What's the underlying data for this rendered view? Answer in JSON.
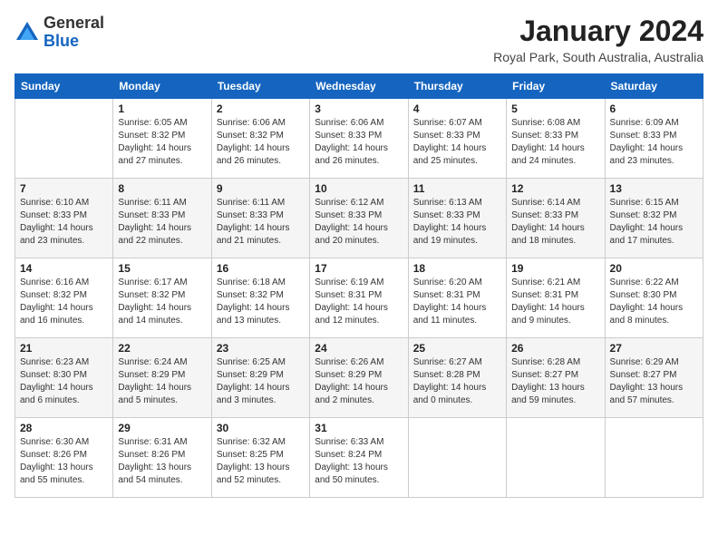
{
  "logo": {
    "general": "General",
    "blue": "Blue"
  },
  "title": "January 2024",
  "subtitle": "Royal Park, South Australia, Australia",
  "days_of_week": [
    "Sunday",
    "Monday",
    "Tuesday",
    "Wednesday",
    "Thursday",
    "Friday",
    "Saturday"
  ],
  "weeks": [
    [
      {
        "day": "",
        "sunrise": "",
        "sunset": "",
        "daylight": ""
      },
      {
        "day": "1",
        "sunrise": "Sunrise: 6:05 AM",
        "sunset": "Sunset: 8:32 PM",
        "daylight": "Daylight: 14 hours and 27 minutes."
      },
      {
        "day": "2",
        "sunrise": "Sunrise: 6:06 AM",
        "sunset": "Sunset: 8:32 PM",
        "daylight": "Daylight: 14 hours and 26 minutes."
      },
      {
        "day": "3",
        "sunrise": "Sunrise: 6:06 AM",
        "sunset": "Sunset: 8:33 PM",
        "daylight": "Daylight: 14 hours and 26 minutes."
      },
      {
        "day": "4",
        "sunrise": "Sunrise: 6:07 AM",
        "sunset": "Sunset: 8:33 PM",
        "daylight": "Daylight: 14 hours and 25 minutes."
      },
      {
        "day": "5",
        "sunrise": "Sunrise: 6:08 AM",
        "sunset": "Sunset: 8:33 PM",
        "daylight": "Daylight: 14 hours and 24 minutes."
      },
      {
        "day": "6",
        "sunrise": "Sunrise: 6:09 AM",
        "sunset": "Sunset: 8:33 PM",
        "daylight": "Daylight: 14 hours and 23 minutes."
      }
    ],
    [
      {
        "day": "7",
        "sunrise": "Sunrise: 6:10 AM",
        "sunset": "Sunset: 8:33 PM",
        "daylight": "Daylight: 14 hours and 23 minutes."
      },
      {
        "day": "8",
        "sunrise": "Sunrise: 6:11 AM",
        "sunset": "Sunset: 8:33 PM",
        "daylight": "Daylight: 14 hours and 22 minutes."
      },
      {
        "day": "9",
        "sunrise": "Sunrise: 6:11 AM",
        "sunset": "Sunset: 8:33 PM",
        "daylight": "Daylight: 14 hours and 21 minutes."
      },
      {
        "day": "10",
        "sunrise": "Sunrise: 6:12 AM",
        "sunset": "Sunset: 8:33 PM",
        "daylight": "Daylight: 14 hours and 20 minutes."
      },
      {
        "day": "11",
        "sunrise": "Sunrise: 6:13 AM",
        "sunset": "Sunset: 8:33 PM",
        "daylight": "Daylight: 14 hours and 19 minutes."
      },
      {
        "day": "12",
        "sunrise": "Sunrise: 6:14 AM",
        "sunset": "Sunset: 8:33 PM",
        "daylight": "Daylight: 14 hours and 18 minutes."
      },
      {
        "day": "13",
        "sunrise": "Sunrise: 6:15 AM",
        "sunset": "Sunset: 8:32 PM",
        "daylight": "Daylight: 14 hours and 17 minutes."
      }
    ],
    [
      {
        "day": "14",
        "sunrise": "Sunrise: 6:16 AM",
        "sunset": "Sunset: 8:32 PM",
        "daylight": "Daylight: 14 hours and 16 minutes."
      },
      {
        "day": "15",
        "sunrise": "Sunrise: 6:17 AM",
        "sunset": "Sunset: 8:32 PM",
        "daylight": "Daylight: 14 hours and 14 minutes."
      },
      {
        "day": "16",
        "sunrise": "Sunrise: 6:18 AM",
        "sunset": "Sunset: 8:32 PM",
        "daylight": "Daylight: 14 hours and 13 minutes."
      },
      {
        "day": "17",
        "sunrise": "Sunrise: 6:19 AM",
        "sunset": "Sunset: 8:31 PM",
        "daylight": "Daylight: 14 hours and 12 minutes."
      },
      {
        "day": "18",
        "sunrise": "Sunrise: 6:20 AM",
        "sunset": "Sunset: 8:31 PM",
        "daylight": "Daylight: 14 hours and 11 minutes."
      },
      {
        "day": "19",
        "sunrise": "Sunrise: 6:21 AM",
        "sunset": "Sunset: 8:31 PM",
        "daylight": "Daylight: 14 hours and 9 minutes."
      },
      {
        "day": "20",
        "sunrise": "Sunrise: 6:22 AM",
        "sunset": "Sunset: 8:30 PM",
        "daylight": "Daylight: 14 hours and 8 minutes."
      }
    ],
    [
      {
        "day": "21",
        "sunrise": "Sunrise: 6:23 AM",
        "sunset": "Sunset: 8:30 PM",
        "daylight": "Daylight: 14 hours and 6 minutes."
      },
      {
        "day": "22",
        "sunrise": "Sunrise: 6:24 AM",
        "sunset": "Sunset: 8:29 PM",
        "daylight": "Daylight: 14 hours and 5 minutes."
      },
      {
        "day": "23",
        "sunrise": "Sunrise: 6:25 AM",
        "sunset": "Sunset: 8:29 PM",
        "daylight": "Daylight: 14 hours and 3 minutes."
      },
      {
        "day": "24",
        "sunrise": "Sunrise: 6:26 AM",
        "sunset": "Sunset: 8:29 PM",
        "daylight": "Daylight: 14 hours and 2 minutes."
      },
      {
        "day": "25",
        "sunrise": "Sunrise: 6:27 AM",
        "sunset": "Sunset: 8:28 PM",
        "daylight": "Daylight: 14 hours and 0 minutes."
      },
      {
        "day": "26",
        "sunrise": "Sunrise: 6:28 AM",
        "sunset": "Sunset: 8:27 PM",
        "daylight": "Daylight: 13 hours and 59 minutes."
      },
      {
        "day": "27",
        "sunrise": "Sunrise: 6:29 AM",
        "sunset": "Sunset: 8:27 PM",
        "daylight": "Daylight: 13 hours and 57 minutes."
      }
    ],
    [
      {
        "day": "28",
        "sunrise": "Sunrise: 6:30 AM",
        "sunset": "Sunset: 8:26 PM",
        "daylight": "Daylight: 13 hours and 55 minutes."
      },
      {
        "day": "29",
        "sunrise": "Sunrise: 6:31 AM",
        "sunset": "Sunset: 8:26 PM",
        "daylight": "Daylight: 13 hours and 54 minutes."
      },
      {
        "day": "30",
        "sunrise": "Sunrise: 6:32 AM",
        "sunset": "Sunset: 8:25 PM",
        "daylight": "Daylight: 13 hours and 52 minutes."
      },
      {
        "day": "31",
        "sunrise": "Sunrise: 6:33 AM",
        "sunset": "Sunset: 8:24 PM",
        "daylight": "Daylight: 13 hours and 50 minutes."
      },
      {
        "day": "",
        "sunrise": "",
        "sunset": "",
        "daylight": ""
      },
      {
        "day": "",
        "sunrise": "",
        "sunset": "",
        "daylight": ""
      },
      {
        "day": "",
        "sunrise": "",
        "sunset": "",
        "daylight": ""
      }
    ]
  ]
}
